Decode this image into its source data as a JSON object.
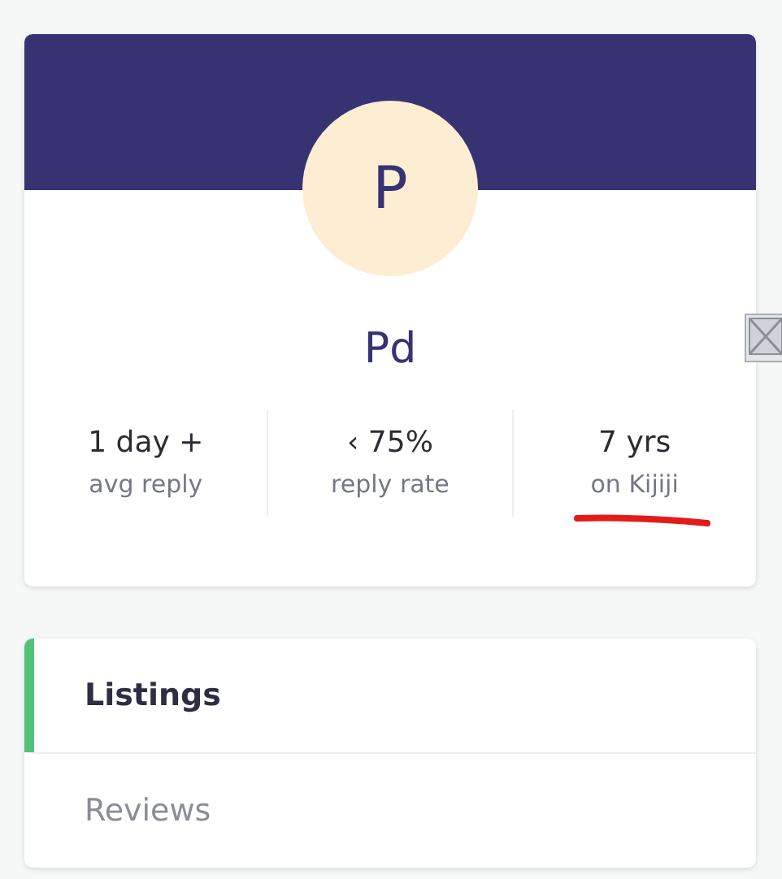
{
  "profile": {
    "avatar_letter": "P",
    "name": "Pd"
  },
  "stats": [
    {
      "value": "1 day +",
      "label": "avg reply",
      "underlined": false
    },
    {
      "value": "‹ 75%",
      "label": "reply rate",
      "underlined": false
    },
    {
      "value": "7 yrs",
      "label": "on Kijiji",
      "underlined": true
    }
  ],
  "tabs": [
    {
      "label": "Listings",
      "selected": true
    },
    {
      "label": "Reviews",
      "selected": false
    }
  ]
}
